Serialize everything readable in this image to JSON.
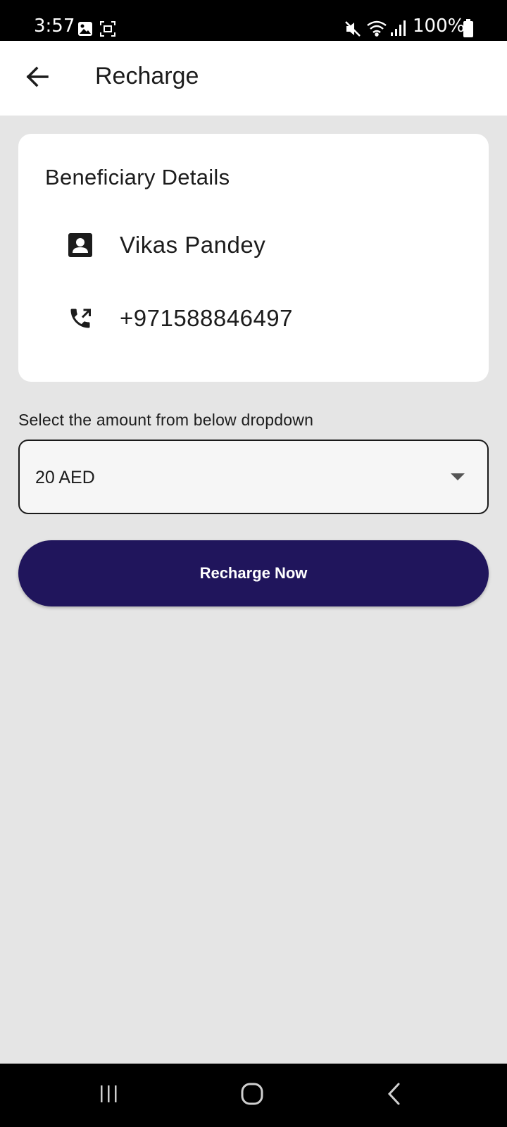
{
  "status_bar": {
    "time": "3:57",
    "battery": "100%",
    "icons": [
      "gallery-icon",
      "screenshot-icon",
      "mute-icon",
      "wifi-icon",
      "signal-icon",
      "battery-icon"
    ]
  },
  "app_bar": {
    "back_icon": "arrow-back-icon",
    "title": "Recharge"
  },
  "beneficiary": {
    "heading": "Beneficiary Details",
    "name": "Vikas Pandey",
    "name_icon": "contact-icon",
    "phone": "+971588846497",
    "phone_icon": "phone-forward-icon"
  },
  "amount": {
    "label": "Select the amount from below dropdown",
    "selected": "20 AED"
  },
  "actions": {
    "recharge_label": "Recharge Now"
  },
  "colors": {
    "primary": "#20155c",
    "background": "#e5e5e5",
    "card": "#ffffff"
  },
  "nav_bar": {
    "icons": [
      "recents-icon",
      "home-icon",
      "back-icon"
    ]
  }
}
